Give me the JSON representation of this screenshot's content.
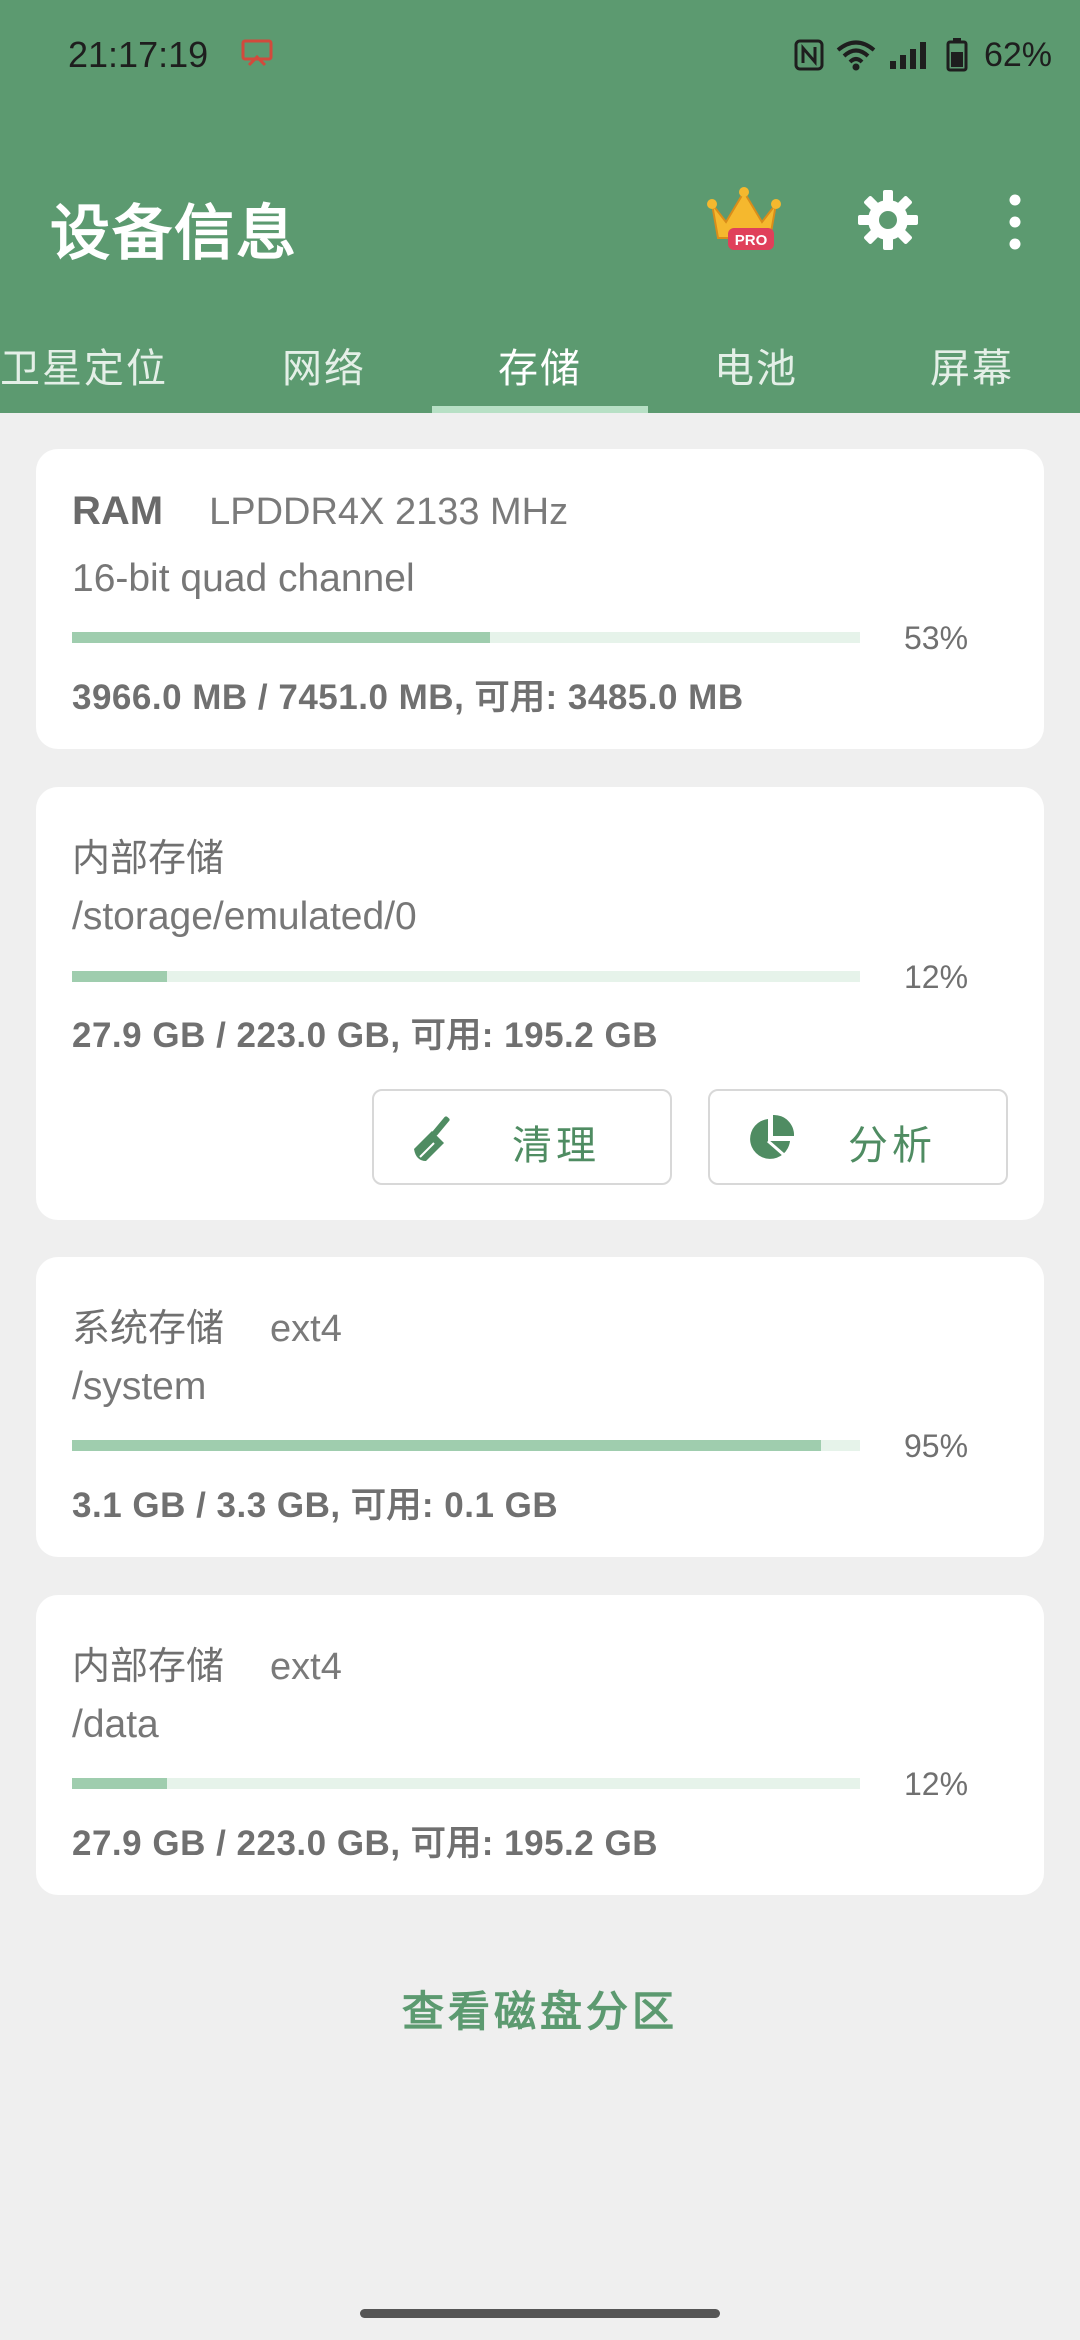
{
  "status": {
    "time": "21:17:19",
    "battery": "62%"
  },
  "app": {
    "title": "设备信息"
  },
  "tabs": [
    {
      "label": "卫星定位"
    },
    {
      "label": "网络"
    },
    {
      "label": "存储",
      "active": true
    },
    {
      "label": "电池"
    },
    {
      "label": "屏幕"
    }
  ],
  "cards": {
    "ram": {
      "title": "RAM",
      "type": "LPDDR4X 2133 MHz",
      "detail": "16-bit quad channel",
      "percent": 53,
      "percent_label": "53%",
      "usage": "3966.0 MB / 7451.0 MB, 可用: 3485.0 MB"
    },
    "internal": {
      "title": "内部存储",
      "path": "/storage/emulated/0",
      "percent": 12,
      "percent_label": "12%",
      "usage": "27.9 GB / 223.0 GB, 可用: 195.2 GB",
      "clean_label": "清理",
      "analyze_label": "分析"
    },
    "system": {
      "title": "系统存储",
      "fs": "ext4",
      "path": "/system",
      "percent": 95,
      "percent_label": "95%",
      "usage": "3.1 GB / 3.3 GB, 可用: 0.1 GB"
    },
    "data": {
      "title": "内部存储",
      "fs": "ext4",
      "path": "/data",
      "percent": 12,
      "percent_label": "12%",
      "usage": "27.9 GB / 223.0 GB, 可用: 195.2 GB"
    }
  },
  "footer": {
    "partitions_link": "查看磁盘分区"
  },
  "colors": {
    "primary": "#5c9a70",
    "bar_fill": "#9fcdae",
    "bar_track": "#e6f3ea",
    "background": "#efefef"
  }
}
